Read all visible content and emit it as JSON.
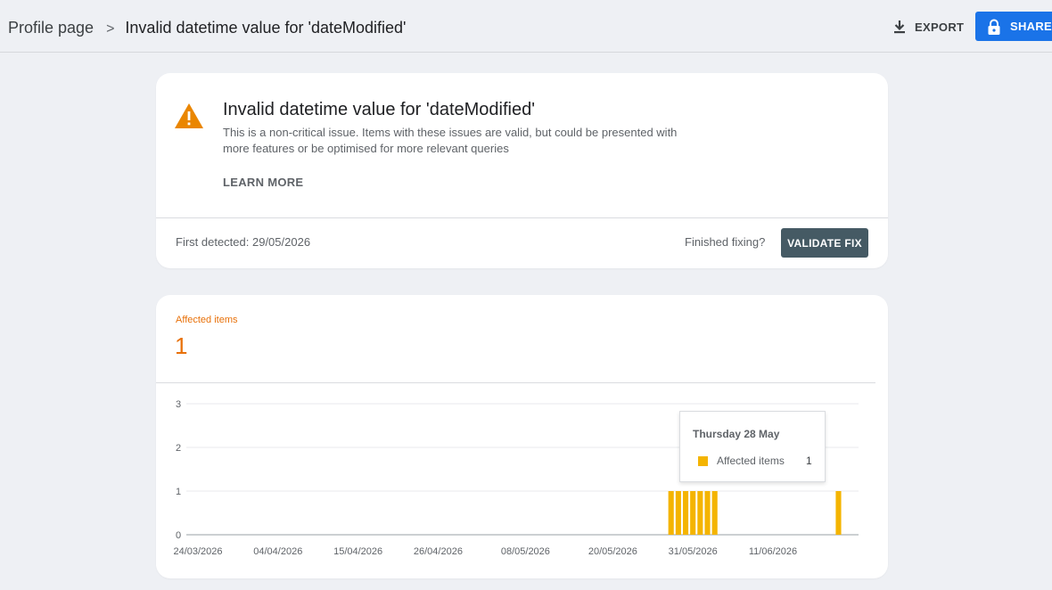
{
  "header": {
    "breadcrumb_root": "Profile page",
    "breadcrumb_separator": ">",
    "breadcrumb_current": "Invalid datetime value for 'dateModified'",
    "export_label": "EXPORT",
    "share_label": "SHARE",
    "share_color": "#1a73e8"
  },
  "issue": {
    "icon": "warning-icon",
    "icon_color": "#ea8600",
    "title": "Invalid datetime value for 'dateModified'",
    "description": "This is a non-critical issue. Items with these issues are valid, but could be presented with more features or be optimised for more relevant queries",
    "learn_more": "LEARN MORE",
    "first_detected": "First detected: 29/05/2026",
    "finished_fixing": "Finished fixing?",
    "validate_fix": "VALIDATE FIX"
  },
  "affected": {
    "label": "Affected items",
    "count": "1",
    "accent_color": "#e8710a"
  },
  "tooltip": {
    "date": "Thursday 28 May",
    "series": "Affected items",
    "value": "1"
  },
  "chart_data": {
    "type": "bar",
    "title": "",
    "xlabel": "",
    "ylabel": "",
    "ylim": [
      0,
      3
    ],
    "yticks": [
      "0",
      "1",
      "2",
      "3"
    ],
    "xticks": [
      "24/03/2026",
      "04/04/2026",
      "15/04/2026",
      "26/04/2026",
      "08/05/2026",
      "20/05/2026",
      "31/05/2026",
      "11/06/2026"
    ],
    "bar_color": "#f4b400",
    "series": [
      {
        "name": "Affected items",
        "x": [
          "28/05/2026",
          "29/05/2026",
          "30/05/2026",
          "31/05/2026",
          "01/06/2026",
          "02/06/2026",
          "03/06/2026",
          "20/06/2026"
        ],
        "values": [
          1,
          1,
          1,
          1,
          1,
          1,
          1,
          1
        ]
      }
    ]
  }
}
